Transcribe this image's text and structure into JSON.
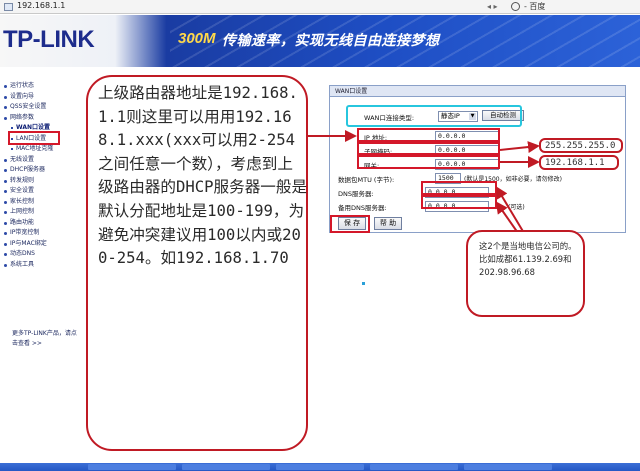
{
  "browser": {
    "address": "192.168.1.1",
    "nav_buttons": "◂ ▸",
    "search_label": "- 百度"
  },
  "header": {
    "logo": "TP-LINK",
    "slogan_number": "300M",
    "slogan_text": "传输速率，实现无线自由连接梦想"
  },
  "sidebar": {
    "items": [
      {
        "label": "运行状态",
        "sub": false
      },
      {
        "label": "设置向导",
        "sub": false
      },
      {
        "label": "QSS安全设置",
        "sub": false
      },
      {
        "label": "网络参数",
        "sub": false
      },
      {
        "label": "WAN口设置",
        "sub": true,
        "active": true
      },
      {
        "label": "LAN口设置",
        "sub": true
      },
      {
        "label": "MAC地址克隆",
        "sub": true
      },
      {
        "label": "无线设置",
        "sub": false
      },
      {
        "label": "DHCP服务器",
        "sub": false
      },
      {
        "label": "转发规则",
        "sub": false
      },
      {
        "label": "安全设置",
        "sub": false
      },
      {
        "label": "家长控制",
        "sub": false
      },
      {
        "label": "上网控制",
        "sub": false
      },
      {
        "label": "路由功能",
        "sub": false
      },
      {
        "label": "IP带宽控制",
        "sub": false
      },
      {
        "label": "IP与MAC绑定",
        "sub": false
      },
      {
        "label": "动态DNS",
        "sub": false
      },
      {
        "label": "系统工具",
        "sub": false
      }
    ],
    "more_text": "更多TP-LINK产品，请点击查看 >>"
  },
  "wan": {
    "title": "WAN口设置",
    "conn_type_label": "WAN口连接类型:",
    "conn_type_value": "静态IP",
    "detect_button": "自动检测",
    "ip_label": "IP 地址:",
    "ip_value": "0.0.0.0",
    "mask_label": "子网掩码:",
    "mask_value": "0.0.0.0",
    "gateway_label": "网关:",
    "gateway_value": "0.0.0.0",
    "mtu_label": "数据包MTU (字节):",
    "mtu_value": "1500",
    "mtu_note": "(默认是1500，如非必要，请勿修改)",
    "dns_label": "DNS服务器:",
    "dns_value": "0.0.0.0",
    "dns2_label": "备用DNS服务器:",
    "dns2_value": "0.0.0.0",
    "dns2_note": "(可选)",
    "save_button": "保 存",
    "help_button": "帮 助"
  },
  "annotations": {
    "main_note": "上级路由器地址是192.168.1.1则这里可以用用192.168.1.xxx(xxx可以用2-254之间任意一个数），考虑到上级路由器的DHCP服务器一般是默认分配地址是100-199，为避免冲突建议用100以内或200-254。如192.168.1.70",
    "mask_value": "255.255.255.0",
    "gateway_value": "192.168.1.1",
    "dns_note": "这2个是当地电信公司的。比如成都61.139.2.69和202.98.96.68"
  },
  "colors": {
    "annotation_red": "#c01a24",
    "highlight_cyan": "#27c6de",
    "banner_blue": "#1e4ec4"
  }
}
